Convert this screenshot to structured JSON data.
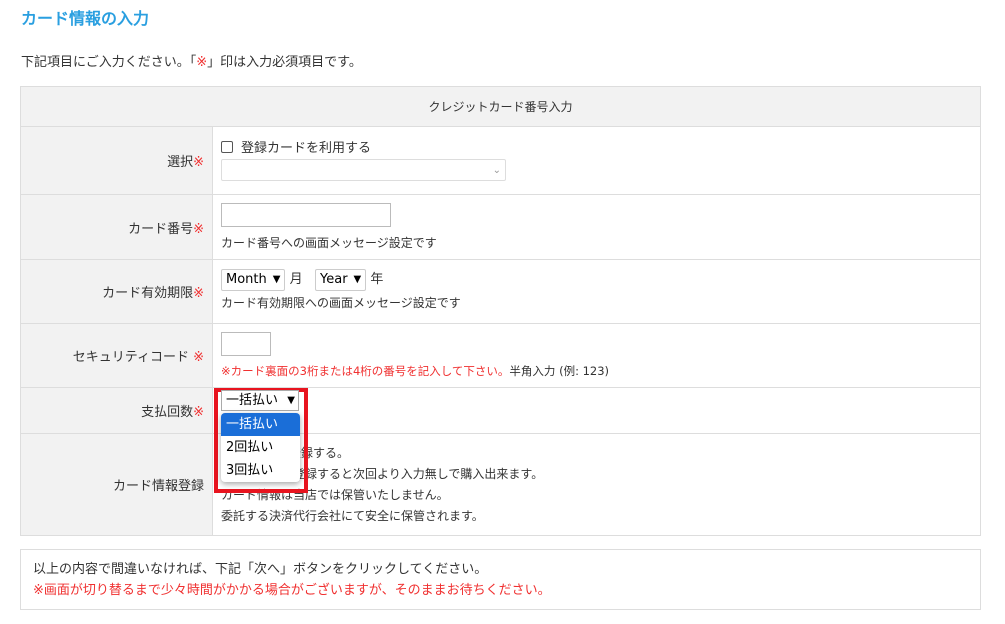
{
  "title": "カード情報の入力",
  "intro": {
    "pre": "下記項目にご入力ください。「",
    "mark": "※",
    "post": "」印は入力必須項目です。"
  },
  "table": {
    "header": "クレジットカード番号入力",
    "required_mark": "※",
    "select": {
      "label": "選択",
      "checkbox_label": "登録カードを利用する",
      "dropdown_value": ""
    },
    "card_number": {
      "label": "カード番号",
      "value": "",
      "message": "カード番号への画面メッセージ設定です"
    },
    "expiry": {
      "label": "カード有効期限",
      "month": "Month",
      "month_unit": "月",
      "year": "Year",
      "year_unit": "年",
      "message": "カード有効期限への画面メッセージ設定です"
    },
    "security": {
      "label": "セキュリティコード ",
      "value": "",
      "warning": "※カード裏面の3桁または4桁の番号を記入して下さい。",
      "hint": "半角入力 (例: 123)"
    },
    "payment": {
      "label": "支払回数",
      "selected": "一括払い",
      "options": [
        "一括払い",
        "2回払い",
        "3回払い"
      ]
    },
    "register": {
      "label": "カード情報登録",
      "checkbox_label": "カードを登録する。",
      "lines": [
        "カード情報を登録すると次回より入力無しで購入出来ます。",
        "カード情報は当店では保管いたしません。",
        "委託する決済代行会社にて安全に保管されます。"
      ]
    }
  },
  "note": {
    "line1": "以上の内容で間違いなければ、下記「次へ」ボタンをクリックしてください。",
    "line2": "※画面が切り替るまで少々時間がかかる場合がございますが、そのままお待ちください。"
  }
}
